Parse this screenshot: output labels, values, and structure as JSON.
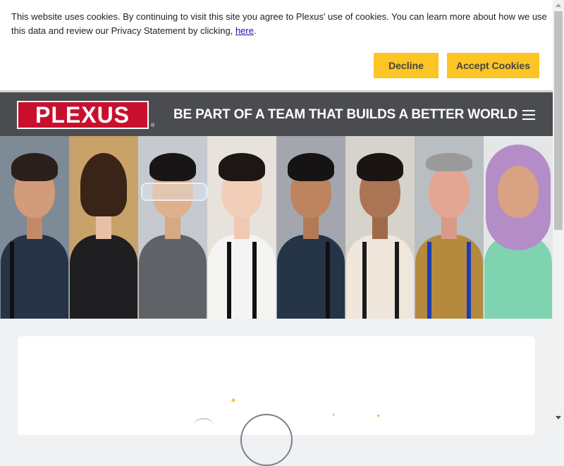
{
  "cookie_banner": {
    "message": "This website uses cookies. By continuing to visit this site you agree to Plexus' use of cookies. You can learn more about how we use this data and review our Privacy Statement by clicking,",
    "link_text": "here",
    "link_suffix": ".",
    "decline_label": "Decline",
    "accept_label": "Accept Cookies"
  },
  "header": {
    "logo_text": "PLEXUS",
    "logo_reg": "®",
    "tagline": "BE PART OF A TEAM THAT BUILDS A BETTER WORLD",
    "menu_icon": "hamburger-menu-icon"
  },
  "hero": {
    "portraits": [
      "employee-1",
      "employee-2",
      "employee-3",
      "employee-4",
      "employee-5",
      "employee-6",
      "employee-7",
      "employee-8"
    ]
  },
  "colors": {
    "accent_yellow": "#fcc425",
    "header_gray": "#4a4c4f",
    "brand_red": "#c8102e"
  }
}
